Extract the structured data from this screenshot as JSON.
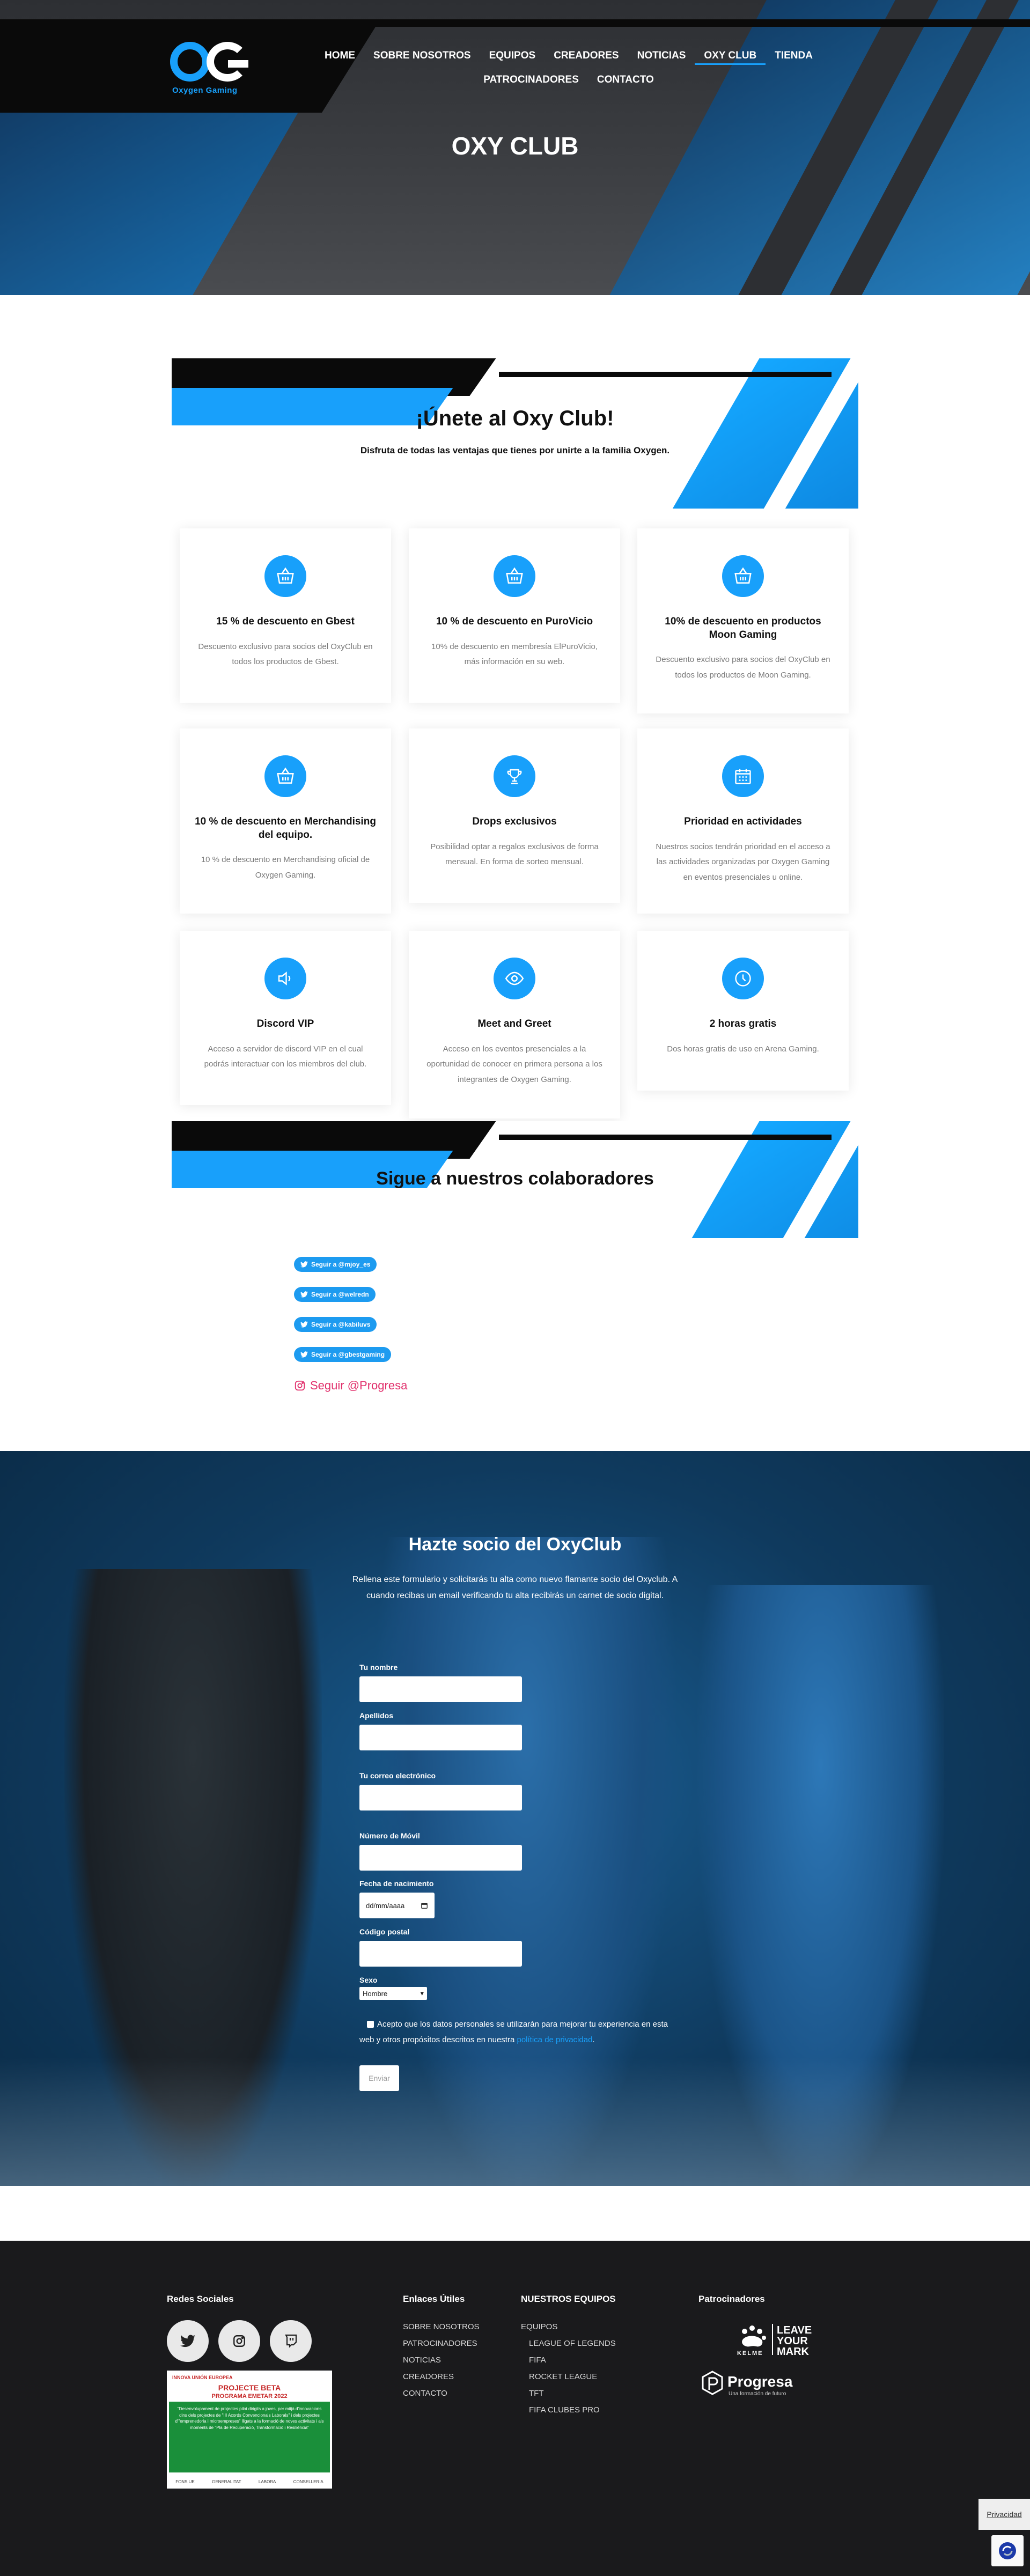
{
  "brand": {
    "logo_text": "Oxygen Gaming",
    "accent": "#18a0fb"
  },
  "nav": {
    "items": [
      "HOME",
      "SOBRE NOSOTROS",
      "EQUIPOS",
      "CREADORES",
      "NOTICIAS",
      "OXY CLUB",
      "TIENDA",
      "PATROCINADORES",
      "CONTACTO"
    ],
    "active": "OXY CLUB"
  },
  "hero": {
    "title": "OXY CLUB"
  },
  "join_banner": {
    "title": "¡Únete al Oxy Club!",
    "subtitle": "Disfruta de todas las ventajas que tienes por unirte a la familia Oxygen."
  },
  "benefits": [
    {
      "icon": "basket-icon",
      "title": "15 % de descuento en Gbest",
      "text": "Descuento exclusivo para socios del OxyClub en todos los productos de Gbest."
    },
    {
      "icon": "basket-icon",
      "title": "10 % de descuento en PuroVicio",
      "text": "10% de descuento en membresía ElPuroVicio, más información en su web."
    },
    {
      "icon": "basket-icon",
      "title": "10% de descuento en productos Moon Gaming",
      "text": "Descuento exclusivo para socios del OxyClub en todos los productos de Moon Gaming."
    },
    {
      "icon": "basket-icon",
      "title": "10 % de descuento en Merchandising del equipo.",
      "text": "10 % de descuento en Merchandising oficial de Oxygen Gaming."
    },
    {
      "icon": "trophy-icon",
      "title": "Drops exclusivos",
      "text": "Posibilidad optar a regalos exclusivos de forma mensual. En forma de sorteo mensual."
    },
    {
      "icon": "calendar-icon",
      "title": "Prioridad en actividades",
      "text": "Nuestros socios tendrán prioridad en el acceso a las actividades organizadas por Oxygen Gaming en eventos presenciales u online."
    },
    {
      "icon": "speaker-icon",
      "title": "Discord VIP",
      "text": "Acceso a servidor de discord VIP en el cual podrás interactuar con los miembros del club."
    },
    {
      "icon": "eye-icon",
      "title": "Meet and Greet",
      "text": "Acceso en los eventos presenciales a la oportunidad de conocer en primera persona a los integrantes de Oxygen Gaming."
    },
    {
      "icon": "clock-icon",
      "title": "2 horas gratis",
      "text": "Dos horas gratis de uso en Arena Gaming."
    }
  ],
  "collab_banner": {
    "title": "Sigue a nuestros colaboradores"
  },
  "follow_buttons": [
    "Seguir a @mjoy_es",
    "Seguir a @welredn",
    "Seguir a @kabiluvs",
    "Seguir a @gbestgaming"
  ],
  "instagram_follow": "Seguir @Progresa",
  "form": {
    "title": "Hazte socio del OxyClub",
    "intro": "Rellena este formulario y solicitarás tu alta como nuevo flamante socio del Oxyclub. A cuando recibas un email verificando tu alta recibirás un carnet de socio digital.",
    "labels": {
      "name": "Tu nombre",
      "surname": "Apellidos",
      "email": "Tu correo electrónico",
      "phone": "Número de Móvil",
      "birth": "Fecha de nacimiento",
      "postal": "Código postal",
      "sex": "Sexo"
    },
    "date_placeholder": "dd/mm/aaaa",
    "sex_selected": "Hombre",
    "consent_text": "Acepto que los datos personales se utilizarán para mejorar tu experiencia en esta web y otros propósitos descritos en nuestra",
    "consent_link": "política de privacidad",
    "submit": "Enviar"
  },
  "footer": {
    "social_heading": "Redes Sociales",
    "social_icons": [
      "twitter-icon",
      "instagram-icon",
      "twitch-icon"
    ],
    "poster": {
      "logos": "INNOVA   UNIÓN EUROPEA",
      "title": "PROJECTE BETA",
      "subtitle": "PROGRAMA EMETAR 2022",
      "body": "\"Desenvolupament de projectes pilot dirigits a joves, per mitjà d'innovacions dins dels projectes de \"III Acords Convencionals Laborals\" i dels projectes d'\"emprenedoria i microempreses\" lligats a la formació de noves activitats i als moments de \"Pla de Recuperació, Transformació i Resiliència\"",
      "foot_logos": [
        "FONS UE",
        "GENERALITAT",
        "LABORA",
        "CONSELLERIA"
      ]
    },
    "links_heading": "Enlaces Útiles",
    "links": [
      "SOBRE NOSOTROS",
      "PATROCINADORES",
      "NOTICIAS",
      "CREADORES",
      "CONTACTO"
    ],
    "teams_heading": "NUESTROS EQUIPOS",
    "teams_root": "EQUIPOS",
    "teams": [
      "LEAGUE OF LEGENDS",
      "FIFA",
      "ROCKET LEAGUE",
      "TFT",
      "FIFA CLUBES PRO"
    ],
    "sponsors_heading": "Patrocinadores",
    "sponsor1_brand": "KELME",
    "sponsor1_slogan": [
      "LEAVE",
      "YOUR",
      "MARK"
    ],
    "sponsor2_name": "Progresa",
    "sponsor2_tagline": "Una formación de futuro",
    "privacy": "Privacidad"
  }
}
